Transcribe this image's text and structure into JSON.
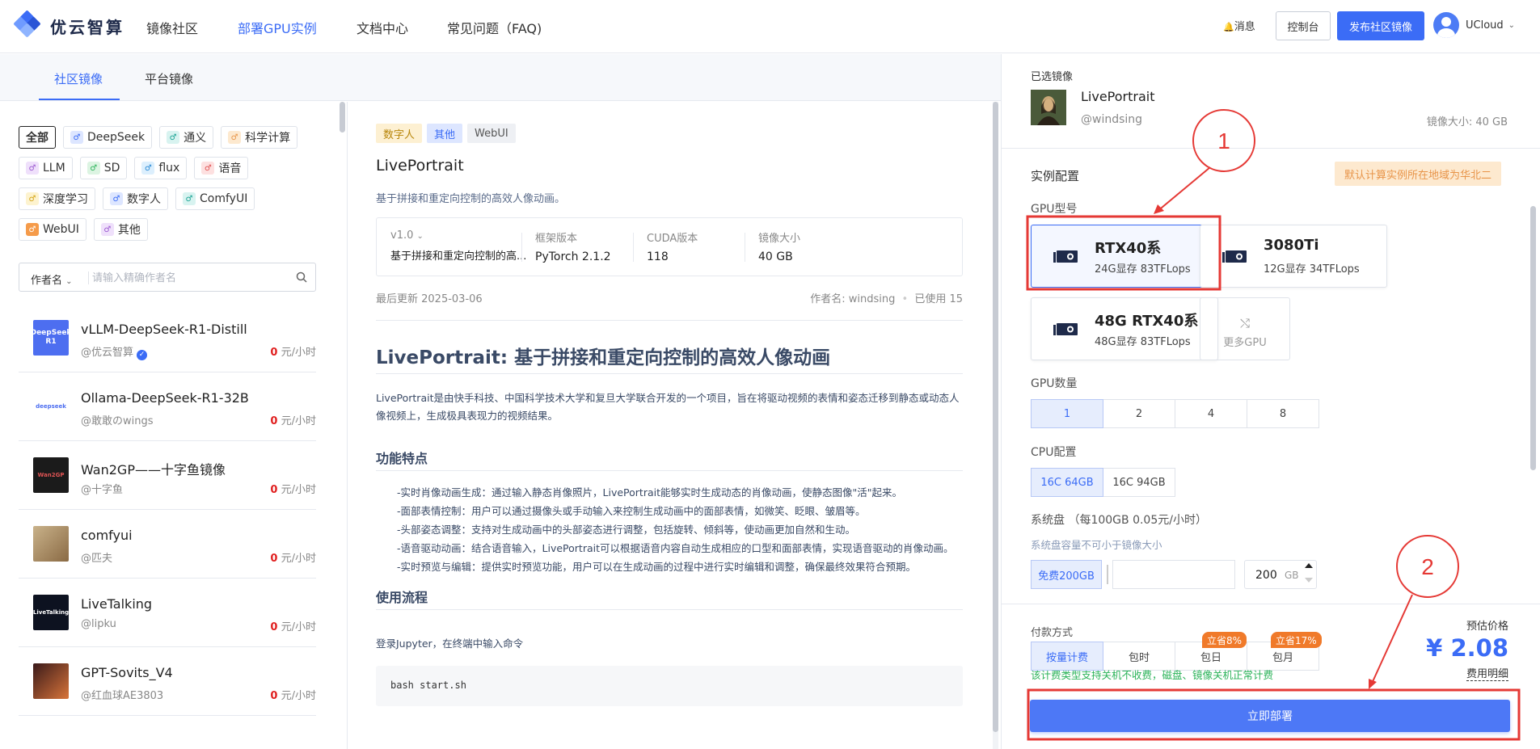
{
  "brand": {
    "name": "优云智算"
  },
  "nav": {
    "items": [
      "镜像社区",
      "部署GPU实例",
      "文档中心",
      "常见问题（FAQ)"
    ],
    "messages": "消息",
    "console": "控制台",
    "publish": "发布社区镜像",
    "user": "UCloud"
  },
  "left": {
    "tabs": [
      "社区镜像",
      "平台镜像"
    ],
    "tags_rows": [
      [
        "全部",
        "DeepSeek",
        "通义",
        "科学计算"
      ],
      [
        "LLM",
        "SD",
        "flux",
        "语音"
      ],
      [
        "深度学习",
        "数字人",
        "ComfyUI"
      ],
      [
        "WebUI",
        "其他"
      ]
    ],
    "search": {
      "category": "作者名",
      "placeholder": "请输入精确作者名"
    },
    "images": [
      {
        "title": "vLLM-DeepSeek-R1-Distill",
        "author": "@优云智算",
        "price": "0",
        "unit": "元/小时",
        "thumb_text": "DeepSeek R1"
      },
      {
        "title": "Ollama-DeepSeek-R1-32B",
        "author": "@敢敢のwings",
        "price": "0",
        "unit": "元/小时",
        "thumb_text": "deepseek"
      },
      {
        "title": "Wan2GP——十字鱼镜像",
        "author": "@十字鱼",
        "price": "0",
        "unit": "元/小时",
        "thumb_text": "Wan2GP"
      },
      {
        "title": "comfyui",
        "author": "@匹夫",
        "price": "0",
        "unit": "元/小时",
        "thumb_text": ""
      },
      {
        "title": "LiveTalking",
        "author": "@lipku",
        "price": "0",
        "unit": "元/小时",
        "thumb_text": "LiveTalking"
      },
      {
        "title": "GPT-Sovits_V4",
        "author": "@红血球AE3803",
        "price": "0",
        "unit": "元/小时",
        "thumb_text": ""
      }
    ]
  },
  "detail": {
    "tags": [
      "数字人",
      "其他",
      "WebUI"
    ],
    "title": "LivePortrait",
    "desc": "基于拼接和重定向控制的高效人像动画。",
    "version_label": "v1.0",
    "version_desc": "基于拼接和重定向控制的高...",
    "framework_label": "框架版本",
    "framework": "PyTorch 2.1.2",
    "cuda_label": "CUDA版本",
    "cuda": "118",
    "size_label": "镜像大小",
    "size": "40 GB",
    "updated": "最后更新 2025-03-06",
    "author": "作者名: windsing",
    "used": "已使用 15",
    "heading": "LivePortrait: 基于拼接和重定向控制的高效人像动画",
    "intro": "LivePortrait是由快手科技、中国科学技术大学和复旦大学联合开发的一个项目，旨在将驱动视频的表情和姿态迁移到静态或动态人像视频上，生成极具表现力的视频结果。",
    "features_title": "功能特点",
    "features": [
      "-实时肖像动画生成：通过输入静态肖像照片，LivePortrait能够实时生成动态的肖像动画，使静态图像\"活\"起来。",
      "-面部表情控制：用户可以通过摄像头或手动输入来控制生成动画中的面部表情，如微笑、眨眼、皱眉等。",
      "-头部姿态调整：支持对生成动画中的头部姿态进行调整，包括旋转、倾斜等，使动画更加自然和生动。",
      "-语音驱动动画：结合语音输入，LivePortrait可以根据语音内容自动生成相应的口型和面部表情，实现语音驱动的肖像动画。",
      "-实时预览与编辑：提供实时预览功能，用户可以在生成动画的过程中进行实时编辑和调整，确保最终效果符合预期。"
    ],
    "usage_title": "使用流程",
    "usage_text": "登录Jupyter，在终端中输入命令",
    "code": "bash start.sh"
  },
  "config": {
    "selected_label": "已选镜像",
    "selected_name": "LivePortrait",
    "selected_author": "@windsing",
    "selected_size": "镜像大小: 40 GB",
    "instance_title": "实例配置",
    "region_note": "默认计算实例所在地域为华北二",
    "gpu_model_label": "GPU型号",
    "gpus": [
      {
        "name": "RTX40系",
        "spec": "24G显存 83TFLops"
      },
      {
        "name": "3080Ti",
        "spec": "12G显存 34TFLops"
      },
      {
        "name": "48G RTX40系",
        "spec": "48G显存 83TFLops"
      }
    ],
    "more_gpu": "更多GPU",
    "gpu_count_label": "GPU数量",
    "gpu_counts": [
      "1",
      "2",
      "4",
      "8"
    ],
    "cpu_label": "CPU配置",
    "cpus": [
      "16C 64GB",
      "16C 94GB"
    ],
    "disk_label": "系统盘 （每100GB 0.05元/小时）",
    "disk_hint": "系统盘容量不可小于镜像大小",
    "disk_free": "免费200GB",
    "disk_value": "200",
    "disk_unit": "GB",
    "pay_label": "付款方式",
    "pay_options": [
      "按量计费",
      "包时",
      "包日",
      "包月"
    ],
    "save_day": "立省8%",
    "save_month": "立省17%",
    "pay_note": "该计费类型支持关机不收费，磁盘、镜像关机正常计费",
    "est_label": "预估价格",
    "est_price": "¥ 2.08",
    "fee_detail": "费用明细",
    "deploy": "立即部署"
  },
  "annotations": [
    "1",
    "2"
  ]
}
